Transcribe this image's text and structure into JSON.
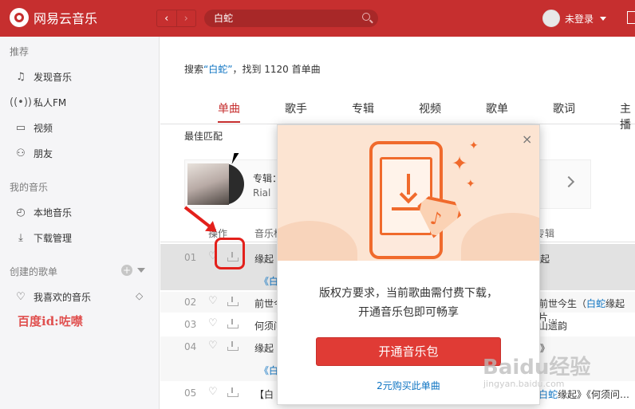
{
  "app": {
    "title": "网易云音乐"
  },
  "nav": {
    "back": "‹",
    "forward": "›"
  },
  "search": {
    "value": "白蛇"
  },
  "user": {
    "label": "未登录"
  },
  "sidebar": {
    "sec1": "推荐",
    "items1": [
      {
        "label": "发现音乐",
        "icon": "music-note-icon"
      },
      {
        "label": "私人FM",
        "icon": "radio-icon"
      },
      {
        "label": "视频",
        "icon": "video-icon"
      },
      {
        "label": "朋友",
        "icon": "friends-icon"
      }
    ],
    "sec2": "我的音乐",
    "items2": [
      {
        "label": "本地音乐",
        "icon": "local-music-icon"
      },
      {
        "label": "下载管理",
        "icon": "download-icon"
      }
    ],
    "sec3": "创建的歌单",
    "fav": "我喜欢的音乐",
    "watermark": "百度id:咗噤"
  },
  "result": {
    "prefix": "搜索",
    "query": "“白蛇”",
    "suffix": "，找到 1120 首单曲"
  },
  "tabs": [
    "单曲",
    "歌手",
    "专辑",
    "视频",
    "歌单",
    "歌词",
    "主播"
  ],
  "best": {
    "label": "最佳匹配",
    "album_label": "专辑：",
    "artist": "Rial",
    "album_partial": "白"
  },
  "table": {
    "header_ops": "操作",
    "header_title": "音乐标",
    "header_album": "专辑"
  },
  "rows": [
    {
      "idx": "01",
      "title": "缘起",
      "sub": "《白蛇",
      "right": "起"
    },
    {
      "idx": "02",
      "title": "前世今",
      "right_pre": "前世今生（",
      "right_hl": "白蛇",
      "right_post": "缘起片…"
    },
    {
      "idx": "03",
      "title": "何须问",
      "right": "山遗韵"
    },
    {
      "idx": "04",
      "title": "缘起",
      "sub": "《白",
      "right": "》"
    },
    {
      "idx": "05",
      "title": "【白",
      "right_pre": "",
      "right_hl": "白蛇",
      "right_post": "缘起》《何须问…"
    }
  ],
  "modal": {
    "line1": "版权方要求，当前歌曲需付费下载，",
    "line2": "开通音乐包即可畅享",
    "buy_button": "开通音乐包",
    "single_link": "2元购买此单曲",
    "close": "×"
  },
  "watermark": {
    "baidu": "Baidu经验",
    "baidu_sub": "jingyan.baidu.com"
  },
  "colors": {
    "brand": "#c62f2f",
    "accent": "#e03b35",
    "link": "#0c73c2"
  }
}
